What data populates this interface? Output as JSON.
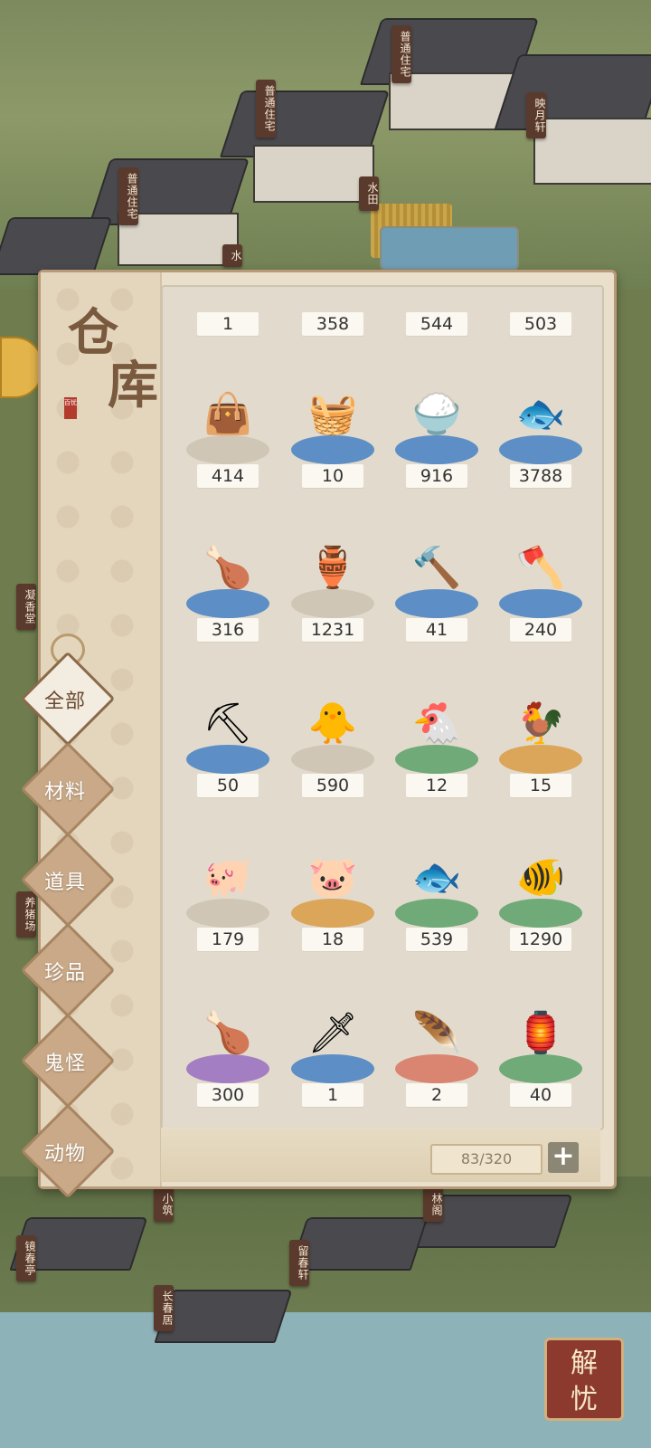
{
  "background": {
    "signs": [
      "普通住宅",
      "普通住宅",
      "普通住宅",
      "映月轩",
      "水田",
      "水",
      "凝香堂",
      "养猪场",
      "小筑",
      "林阁",
      "留春轩",
      "镜春亭",
      "长春居"
    ]
  },
  "warehouse": {
    "title_chars": [
      "仓",
      "库"
    ],
    "seal_text": "百忧",
    "tabs": [
      {
        "label": "全部",
        "active": true
      },
      {
        "label": "材料",
        "active": false
      },
      {
        "label": "道具",
        "active": false
      },
      {
        "label": "珍品",
        "active": false
      },
      {
        "label": "鬼怪",
        "active": false
      },
      {
        "label": "动物",
        "active": false
      }
    ],
    "top_row_counts": [
      "1",
      "358",
      "544",
      "503"
    ],
    "items": [
      {
        "icon": "grain-bag-icon",
        "glyph": "👜",
        "count": "414",
        "disc": "gray"
      },
      {
        "icon": "rice-basket-icon",
        "glyph": "🧺",
        "count": "10",
        "disc": "blue"
      },
      {
        "icon": "rice-sack-icon",
        "glyph": "🍚",
        "count": "916",
        "disc": "blue"
      },
      {
        "icon": "fish-meat-icon",
        "glyph": "🐟",
        "count": "3788",
        "disc": "blue"
      },
      {
        "icon": "roast-chicken-raw-icon",
        "glyph": "🍗",
        "count": "316",
        "disc": "blue"
      },
      {
        "icon": "wine-jar-icon",
        "glyph": "🏺",
        "count": "1231",
        "disc": "gray"
      },
      {
        "icon": "hammer-icon",
        "glyph": "🔨",
        "count": "41",
        "disc": "blue"
      },
      {
        "icon": "axe-icon",
        "glyph": "🪓",
        "count": "240",
        "disc": "blue"
      },
      {
        "icon": "shovel-icon",
        "glyph": "⛏",
        "count": "50",
        "disc": "blue"
      },
      {
        "icon": "chick-icon",
        "glyph": "🐥",
        "count": "590",
        "disc": "gray"
      },
      {
        "icon": "hen-icon",
        "glyph": "🐔",
        "count": "12",
        "disc": "green"
      },
      {
        "icon": "rooster-icon",
        "glyph": "🐓",
        "count": "15",
        "disc": "orange"
      },
      {
        "icon": "pig-icon",
        "glyph": "🐖",
        "count": "179",
        "disc": "gray"
      },
      {
        "icon": "sparkle-pig-icon",
        "glyph": "🐷",
        "count": "18",
        "disc": "orange"
      },
      {
        "icon": "blue-fish-icon",
        "glyph": "🐟",
        "count": "539",
        "disc": "green"
      },
      {
        "icon": "big-blue-fish-icon",
        "glyph": "🐠",
        "count": "1290",
        "disc": "green"
      },
      {
        "icon": "roast-chicken-dish-icon",
        "glyph": "🍗",
        "count": "300",
        "disc": "purple"
      },
      {
        "icon": "wooden-sword-icon",
        "glyph": "🗡",
        "count": "1",
        "disc": "blue"
      },
      {
        "icon": "duster-icon",
        "glyph": "🪶",
        "count": "2",
        "disc": "red"
      },
      {
        "icon": "talisman-charm-icon",
        "glyph": "🏮",
        "count": "40",
        "disc": "green"
      }
    ],
    "capacity": "83/320",
    "add_label": "+"
  },
  "corner_button": {
    "line1": "解",
    "line2": "忧"
  }
}
